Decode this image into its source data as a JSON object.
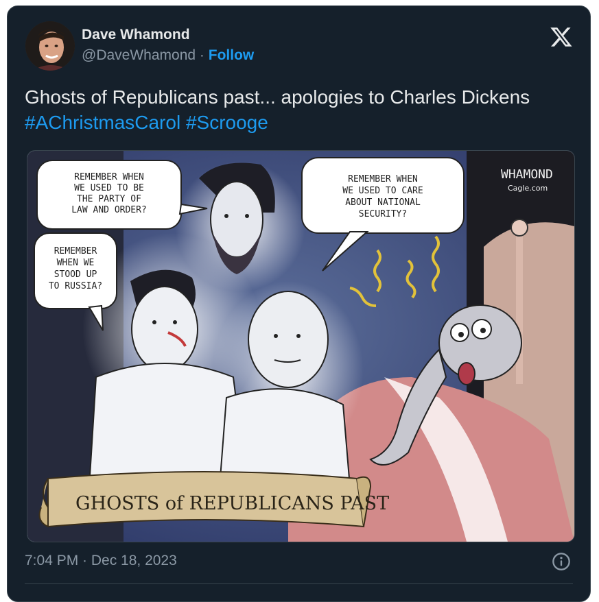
{
  "author": {
    "name": "Dave Whamond",
    "handle": "@DaveWhamond",
    "separator": "·",
    "follow_label": "Follow"
  },
  "tweet": {
    "text": "Ghosts of Republicans past... apologies to Charles Dickens",
    "hashtags": [
      "#AChristmasCarol",
      "#Scrooge"
    ]
  },
  "cartoon": {
    "bubbles": {
      "lincoln": [
        "REMEMBER WHEN",
        "WE USED TO BE",
        "THE PARTY OF",
        "LAW AND ORDER?"
      ],
      "reagan": [
        "REMEMBER",
        "WHEN WE",
        "STOOD UP",
        "TO RUSSIA?"
      ],
      "mccain": [
        "REMEMBER WHEN",
        "WE USED TO CARE",
        "ABOUT NATIONAL",
        "SECURITY?"
      ]
    },
    "signature": "WHAMOND",
    "signature_site": "Cagle.com",
    "banner": "GHOSTS of REPUBLICANS PAST"
  },
  "meta": {
    "timestamp": "7:04 PM · Dec 18, 2023"
  },
  "colors": {
    "background": "#15202b",
    "text": "#e7e9ea",
    "muted": "#8b98a5",
    "accent": "#1d9bf0",
    "border": "#38444d"
  },
  "icons": {
    "close": "x-logo-icon",
    "info": "info-icon"
  }
}
